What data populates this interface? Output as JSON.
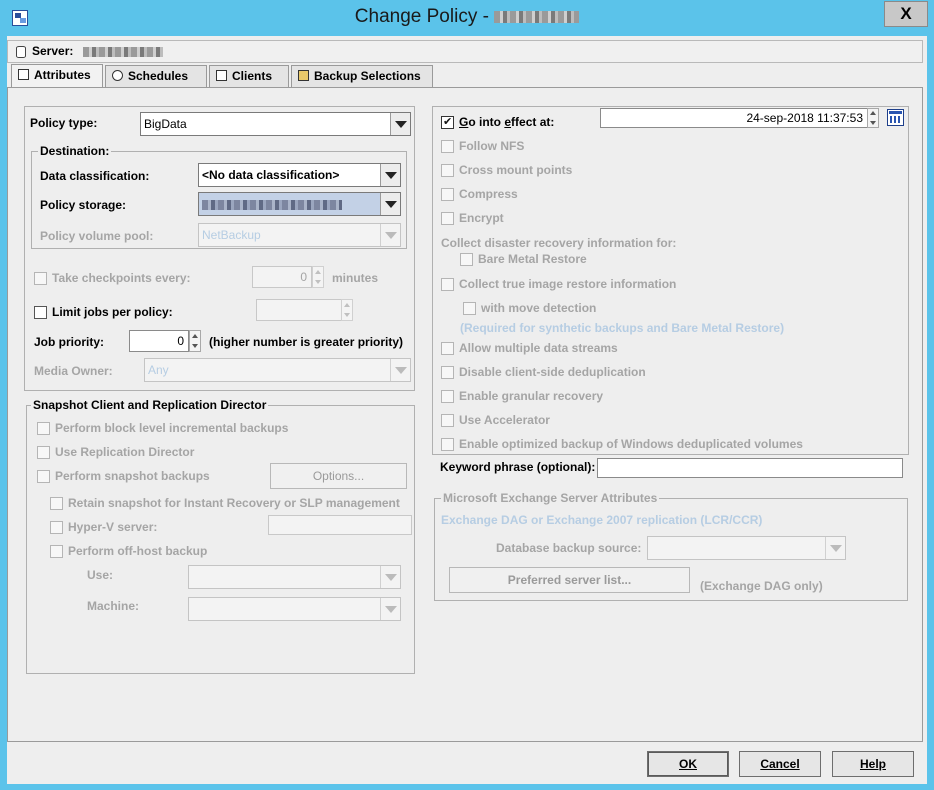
{
  "window": {
    "title": "Change Policy -",
    "close_label": "X"
  },
  "server": {
    "label": "Server:"
  },
  "tabs": [
    {
      "label": "Attributes"
    },
    {
      "label": "Schedules"
    },
    {
      "label": "Clients"
    },
    {
      "label": "Backup Selections"
    }
  ],
  "attributes": {
    "policy_type_label": "Policy type:",
    "policy_type_value": "BigData",
    "destination_legend": "Destination:",
    "data_classification_label": "Data classification:",
    "data_classification_value": "<No data classification>",
    "policy_storage_label": "Policy storage:",
    "policy_volume_pool_label": "Policy volume pool:",
    "policy_volume_pool_value": "NetBackup",
    "take_checkpoints_label": "Take checkpoints every:",
    "take_checkpoints_value": "0",
    "minutes_label": "minutes",
    "limit_jobs_label": "Limit jobs per policy:",
    "job_priority_label": "Job priority:",
    "job_priority_value": "0",
    "job_priority_hint": "(higher number is greater priority)",
    "media_owner_label": "Media Owner:",
    "media_owner_value": "Any"
  },
  "snapshot": {
    "legend": "Snapshot Client and Replication Director",
    "block_level_label": "Perform block level incremental backups",
    "replication_director_label": "Use Replication Director",
    "snapshot_backups_label": "Perform snapshot backups",
    "options_button": "Options...",
    "retain_snapshot_label": "Retain snapshot for Instant Recovery or SLP management",
    "hyperv_label": "Hyper-V server:",
    "offhost_label": "Perform off-host backup",
    "use_label": "Use:",
    "machine_label": "Machine:"
  },
  "right": {
    "go_into_effect_label": "Go into effect at:",
    "go_into_effect_value": "24-sep-2018 11:37:53",
    "follow_nfs_label": "Follow NFS",
    "cross_mount_label": "Cross mount points",
    "compress_label": "Compress",
    "encrypt_label": "Encrypt",
    "collect_dr_label": "Collect disaster recovery information for:",
    "bare_metal_label": "Bare Metal Restore",
    "true_image_label": "Collect true image restore information",
    "move_detection_label": "with move detection",
    "required_note": "(Required for synthetic backups and Bare Metal Restore)",
    "multiple_streams_label": "Allow multiple data streams",
    "disable_dedup_label": "Disable client-side deduplication",
    "granular_label": "Enable granular recovery",
    "accelerator_label": "Use Accelerator",
    "optimized_backup_label": "Enable optimized backup of Windows deduplicated volumes",
    "keyword_label": "Keyword phrase (optional):",
    "keyword_value": ""
  },
  "exchange": {
    "legend": "Microsoft Exchange Server Attributes",
    "dag_label": "Exchange DAG or Exchange 2007 replication (LCR/CCR)",
    "db_source_label": "Database backup source:",
    "preferred_button": "Preferred server list...",
    "dag_only_label": "(Exchange DAG only)"
  },
  "buttons": {
    "ok": "OK",
    "cancel": "Cancel",
    "help": "Help"
  },
  "state": {
    "go_into_effect_checked": true,
    "all_other_checkboxes_checked": false
  }
}
